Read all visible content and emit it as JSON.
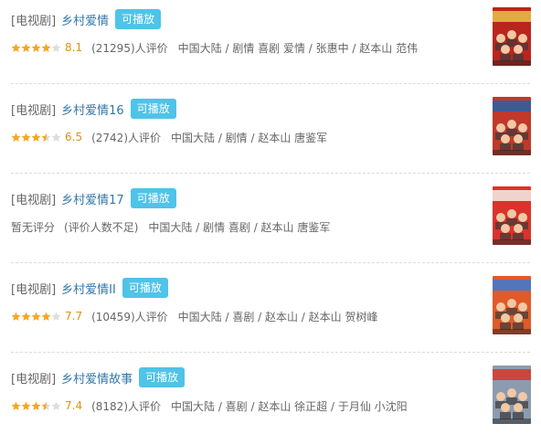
{
  "results": [
    {
      "category": "[电视剧]",
      "title": "乡村爱情",
      "badge": "可播放",
      "stars": 4,
      "rating": "8.1",
      "count": "(21295)人评价",
      "meta": "中国大陆 / 剧情 喜剧 爱情 / 张惠中 / 赵本山 范伟",
      "poster": {
        "bg": "#b8261f",
        "accent": "#e7c24a"
      }
    },
    {
      "category": "[电视剧]",
      "title": "乡村爱情16",
      "badge": "可播放",
      "stars": 3.5,
      "rating": "6.5",
      "count": "(2742)人评价",
      "meta": "中国大陆 / 剧情 / 赵本山 唐鉴军",
      "poster": {
        "bg": "#c0392b",
        "accent": "#2b5ea8"
      }
    },
    {
      "category": "[电视剧]",
      "title": "乡村爱情17",
      "badge": "可播放",
      "norating": "暂无评分",
      "count": "(评价人数不足)",
      "meta": "中国大陆 / 剧情 喜剧 / 赵本山 唐鉴军",
      "poster": {
        "bg": "#d9342b",
        "accent": "#f4f0e8"
      }
    },
    {
      "category": "[电视剧]",
      "title": "乡村爱情II",
      "badge": "可播放",
      "stars": 4,
      "rating": "7.7",
      "count": "(10459)人评价",
      "meta": "中国大陆 / 喜剧 / 赵本山 / 赵本山 贺树峰",
      "poster": {
        "bg": "#e05a2a",
        "accent": "#3a7bd5"
      }
    },
    {
      "category": "[电视剧]",
      "title": "乡村爱情故事",
      "badge": "可播放",
      "stars": 3.5,
      "rating": "7.4",
      "count": "(8182)人评价",
      "meta": "中国大陆 / 喜剧 / 赵本山 徐正超 / 于月仙 小沈阳",
      "poster": {
        "bg": "#8c9cae",
        "accent": "#d23a2a"
      }
    }
  ],
  "colors": {
    "star_on": "#f5a623",
    "star_off": "#dddddd"
  }
}
